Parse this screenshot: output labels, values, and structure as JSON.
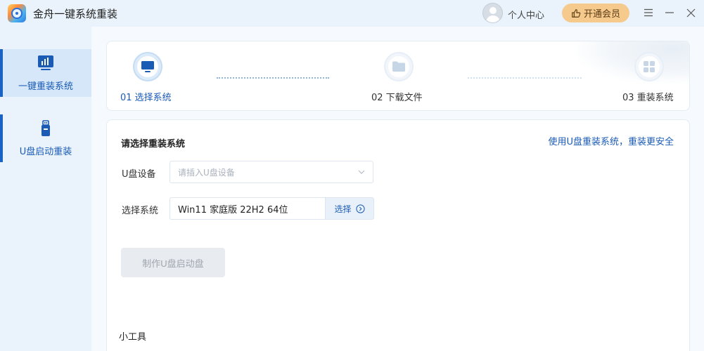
{
  "app": {
    "title": "金舟一键系统重装"
  },
  "header": {
    "user_center": "个人中心",
    "vip_label": "开通会员"
  },
  "sidebar": {
    "items": [
      {
        "label": "一键重装系统",
        "active": true,
        "icon": "monitor-chart-icon"
      },
      {
        "label": "U盘启动重装",
        "active": false,
        "icon": "usb-drive-icon"
      }
    ]
  },
  "steps": [
    {
      "label": "01 选择系统",
      "icon": "monitor-icon",
      "state": "active"
    },
    {
      "label": "02 下载文件",
      "icon": "folder-icon",
      "state": "inactive"
    },
    {
      "label": "03 重装系统",
      "icon": "grid-icon",
      "state": "inactive"
    }
  ],
  "panel": {
    "title": "请选择重装系统",
    "link": "使用U盘重装系统，重装更安全",
    "usb_label": "U盘设备",
    "usb_placeholder": "请插入U盘设备",
    "system_label": "选择系统",
    "system_value": "Win11 家庭版 22H2 64位",
    "choose_label": "选择",
    "make_button": "制作U盘启动盘",
    "tools_label": "小工具"
  },
  "colors": {
    "accent": "#1a5bb5",
    "vip": "#f6c98c",
    "sidebar_bg": "#eaf3fb",
    "active_item_bg": "#d5e7f8"
  }
}
